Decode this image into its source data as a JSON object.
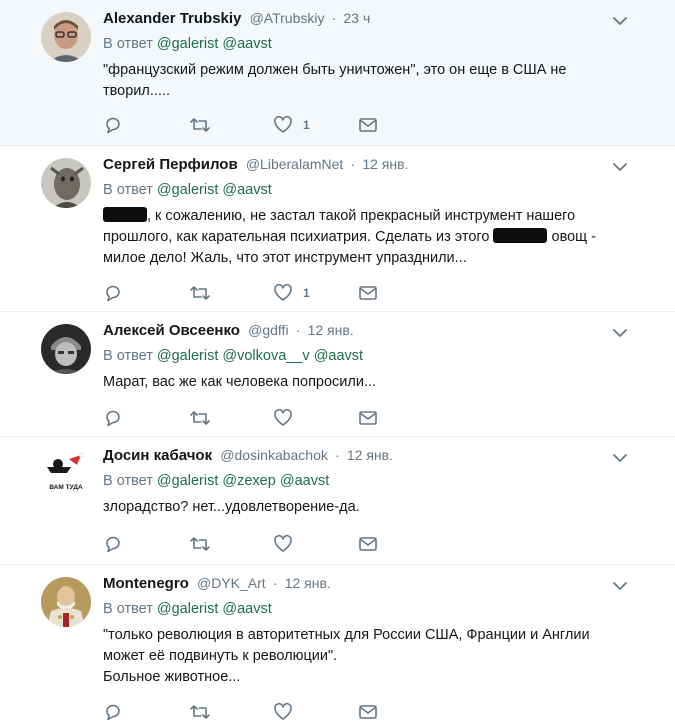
{
  "tweets": [
    {
      "name": "Alexander Trubskiy",
      "handle": "@ATrubskiy",
      "time": "23 ч",
      "reply_prefix": "В ответ",
      "mentions": [
        "@galerist",
        "@aavst"
      ],
      "lines": [
        "\"французский режим должен быть уничтожен\", это он еще в США не",
        "творил....."
      ],
      "likes": "1",
      "highlighted": true
    },
    {
      "name": "Сергей Перфилов",
      "handle": "@LiberalamNet",
      "time": "12 янв.",
      "reply_prefix": "В ответ",
      "mentions": [
        "@galerist",
        "@aavst"
      ],
      "line1": ", к сожалению, не застал такой прекрасный инструмент нашего",
      "line2a": "прошлого, как карательная психиатрия. Сделать из этого",
      "line2b": " овощ -",
      "line3": "милое дело! Жаль, что этот инструмент упразднили...",
      "likes": "1"
    },
    {
      "name": "Алексей Овсеенко",
      "handle": "@gdffi",
      "time": "12 янв.",
      "reply_prefix": "В ответ",
      "mentions": [
        "@galerist",
        "@volkova__v",
        "@aavst"
      ],
      "lines": [
        "Марат, вас же как человека попросили..."
      ]
    },
    {
      "name": "Досин кабачок",
      "handle": "@dosinkabachok",
      "time": "12 янв.",
      "reply_prefix": "В ответ",
      "mentions": [
        "@galerist",
        "@zexep",
        "@aavst"
      ],
      "lines": [
        "злорадство? нет...удовлетворение-да."
      ],
      "avatar_caption": "ВАМ ТУДА"
    },
    {
      "name": "Montenegro",
      "handle": "@DYK_Art",
      "time": "12 янв.",
      "reply_prefix": "В ответ",
      "mentions": [
        "@galerist",
        "@aavst"
      ],
      "lines": [
        "\"только революция в авторитетных для России США, Франции и Англии",
        "может её подвинуть к революции\".",
        "Больное животное..."
      ]
    }
  ],
  "colors": {
    "text": "#14171a",
    "muted": "#657786",
    "mention": "#1f6d4c",
    "highlight_bg": "#f5f8fa",
    "divider": "#e6ecf0"
  },
  "icons": [
    "reply-icon",
    "retweet-icon",
    "like-icon",
    "direct-message-icon",
    "chevron-down-icon"
  ]
}
